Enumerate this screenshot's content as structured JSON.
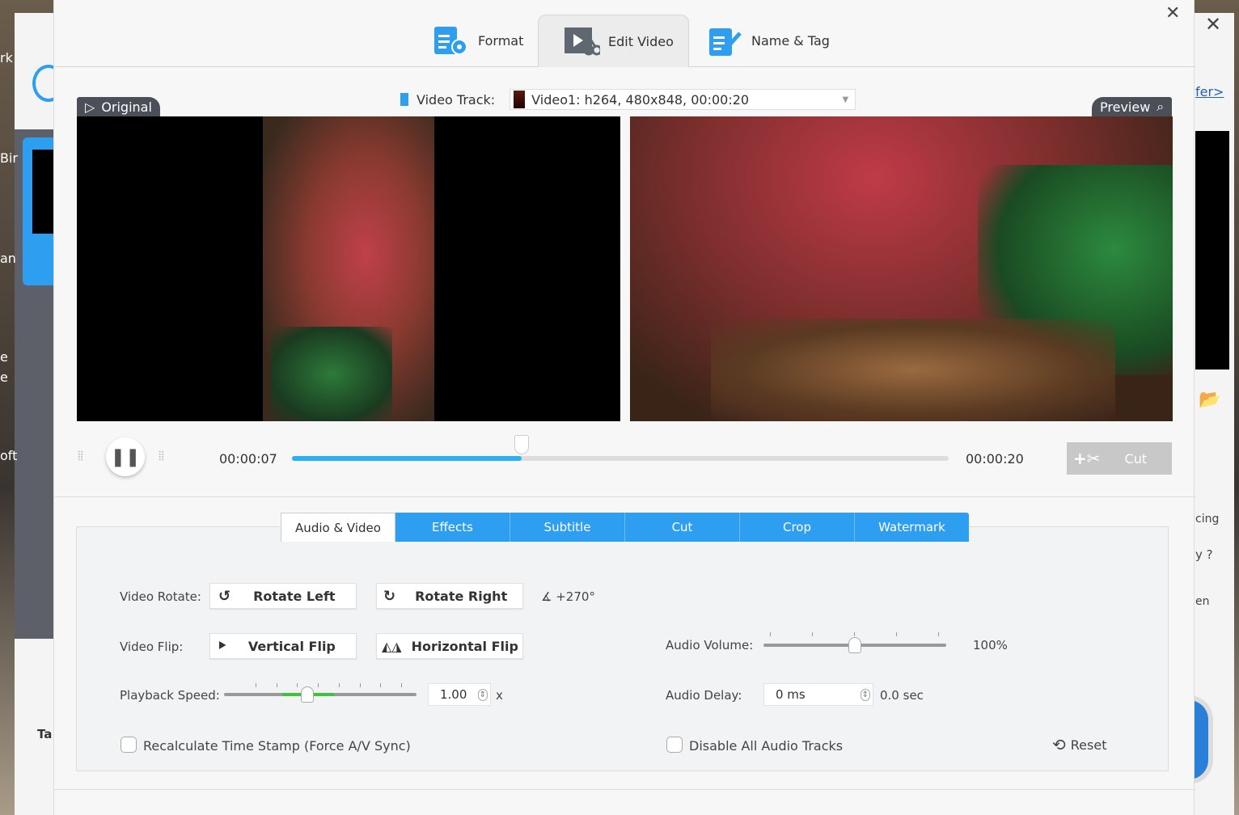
{
  "background_app": {
    "fragments": [
      "rk",
      "Bir",
      "an",
      "e",
      "e",
      "oft",
      "n",
      "Ta"
    ],
    "offer_link": "fer>",
    "right_texts": [
      "cing",
      "y ?",
      "en"
    ]
  },
  "tabs": [
    {
      "label": "Format",
      "icon": "format-gear-icon"
    },
    {
      "label": "Edit Video",
      "icon": "film-scissors-icon",
      "active": true
    },
    {
      "label": "Name & Tag",
      "icon": "edit-pen-icon"
    }
  ],
  "video_track": {
    "label": "Video Track:",
    "value": "Video1: h264, 480x848, 00:00:20"
  },
  "original_label": "Original",
  "preview_label": "Preview",
  "player": {
    "current_time": "00:00:07",
    "total_time": "00:00:20",
    "progress_percent": 35,
    "cut_label": "Cut",
    "state": "playing"
  },
  "edit_tabs": [
    {
      "label": "Audio & Video",
      "active": true
    },
    {
      "label": "Effects"
    },
    {
      "label": "Subtitle"
    },
    {
      "label": "Cut"
    },
    {
      "label": "Crop"
    },
    {
      "label": "Watermark"
    }
  ],
  "controls": {
    "video_rotate_label": "Video Rotate:",
    "rotate_left": "Rotate Left",
    "rotate_right": "Rotate Right",
    "rotation_value": "+270°",
    "video_flip_label": "Video Flip:",
    "vertical_flip": "Vertical Flip",
    "horizontal_flip": "Horizontal Flip",
    "playback_speed_label": "Playback Speed:",
    "playback_speed": "1.00",
    "speed_unit": "x",
    "recalc_label": "Recalculate Time Stamp (Force A/V Sync)",
    "recalc_checked": false,
    "audio_volume_label": "Audio Volume:",
    "audio_volume": "100%",
    "audio_volume_fraction": 0.5,
    "audio_delay_label": "Audio Delay:",
    "audio_delay": "0 ms",
    "audio_delay_sec": "0.0 sec",
    "disable_audio_label": "Disable All Audio Tracks",
    "disable_audio_checked": false,
    "reset_label": "Reset"
  },
  "colors": {
    "accent": "#2e9ef0",
    "speed_green": "#3cc43c"
  }
}
